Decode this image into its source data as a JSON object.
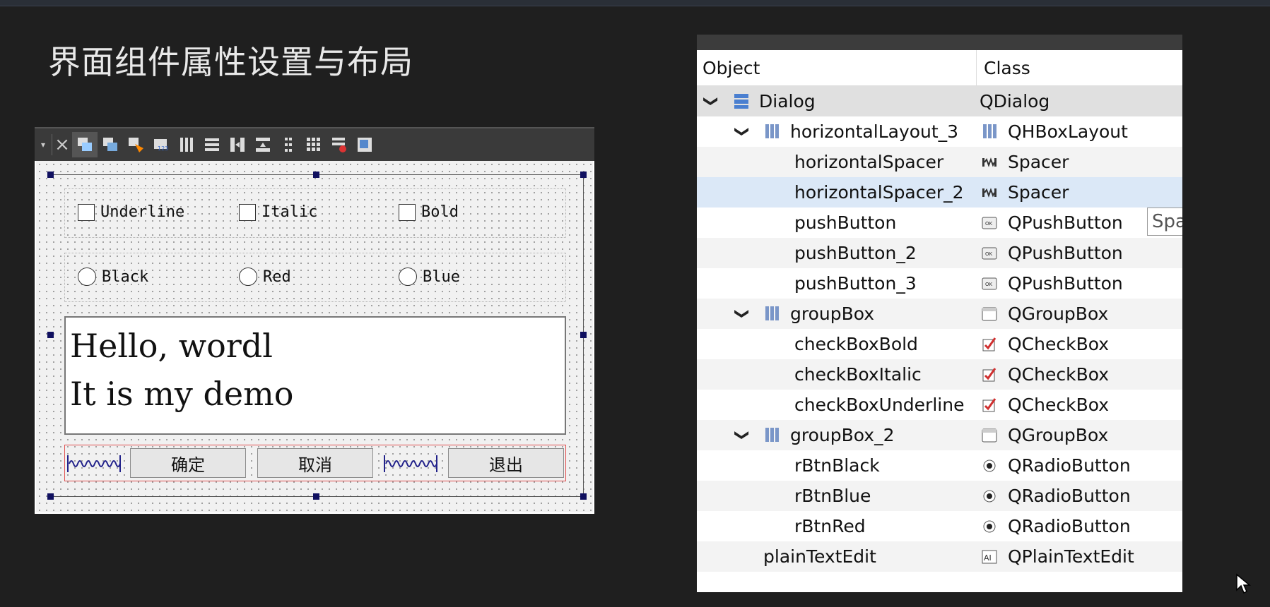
{
  "slide": {
    "title": "界面组件属性设置与布局"
  },
  "toolbar": {
    "icons": [
      "dropdown-arrow-icon",
      "close-icon",
      "edit-widgets-icon",
      "edit-signals-icon",
      "edit-buddies-icon",
      "edit-tab-order-icon",
      "layout-horizontal-icon",
      "layout-vertical-icon",
      "layout-horizontal-splitter-icon",
      "layout-vertical-splitter-icon",
      "layout-form-icon",
      "layout-grid-icon",
      "break-layout-icon",
      "adjust-size-icon"
    ]
  },
  "form": {
    "checkboxes": [
      {
        "label": "Underline",
        "checked": false
      },
      {
        "label": "Italic",
        "checked": false
      },
      {
        "label": "Bold",
        "checked": false
      }
    ],
    "radios": [
      {
        "label": "Black",
        "checked": false
      },
      {
        "label": "Red",
        "checked": false
      },
      {
        "label": "Blue",
        "checked": false
      }
    ],
    "text_line1": "Hello, wordl",
    "text_line2": "It is my demo",
    "buttons": {
      "ok": "确定",
      "cancel": "取消",
      "exit": "退出"
    }
  },
  "inspector": {
    "col_object": "Object",
    "col_class": "Class",
    "rows": [
      {
        "name": "Dialog",
        "class": "QDialog",
        "class_icon": "dialog-icon"
      },
      {
        "name": "horizontalLayout_3",
        "class": "QHBoxLayout",
        "class_icon": "hbox-layout-icon"
      },
      {
        "name": "horizontalSpacer",
        "class": "Spacer",
        "class_icon": "spacer-icon"
      },
      {
        "name": "horizontalSpacer_2",
        "class": "Spacer",
        "class_icon": "spacer-icon"
      },
      {
        "name": "pushButton",
        "class": "QPushButton",
        "class_icon": "pushbutton-icon"
      },
      {
        "name": "pushButton_2",
        "class": "QPushButton",
        "class_icon": "pushbutton-icon"
      },
      {
        "name": "pushButton_3",
        "class": "QPushButton",
        "class_icon": "pushbutton-icon"
      },
      {
        "name": "groupBox",
        "class": "QGroupBox",
        "class_icon": "groupbox-icon"
      },
      {
        "name": "checkBoxBold",
        "class": "QCheckBox",
        "class_icon": "checkbox-icon"
      },
      {
        "name": "checkBoxItalic",
        "class": "QCheckBox",
        "class_icon": "checkbox-icon"
      },
      {
        "name": "checkBoxUnderline",
        "class": "QCheckBox",
        "class_icon": "checkbox-icon"
      },
      {
        "name": "groupBox_2",
        "class": "QGroupBox",
        "class_icon": "groupbox-icon"
      },
      {
        "name": "rBtnBlack",
        "class": "QRadioButton",
        "class_icon": "radiobutton-icon"
      },
      {
        "name": "rBtnBlue",
        "class": "QRadioButton",
        "class_icon": "radiobutton-icon"
      },
      {
        "name": "rBtnRed",
        "class": "QRadioButton",
        "class_icon": "radiobutton-icon"
      },
      {
        "name": "plainTextEdit",
        "class": "QPlainTextEdit",
        "class_icon": "plaintextedit-icon"
      }
    ],
    "tooltip": "Spa"
  },
  "colors": {
    "background": "#1f1f1f",
    "selection": "#dbe8f7",
    "layout_red": "#e05050",
    "handle": "#101060"
  }
}
